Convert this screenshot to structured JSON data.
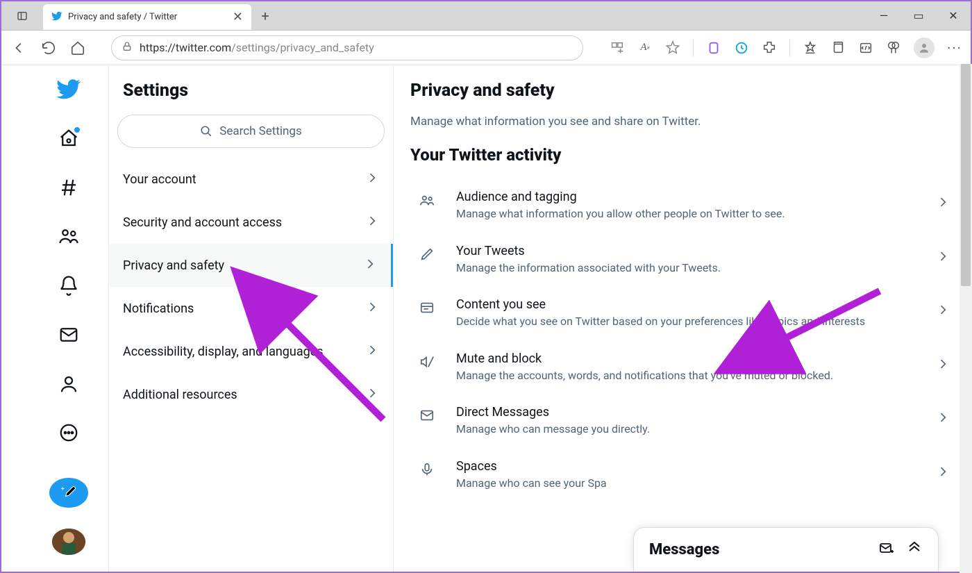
{
  "browser": {
    "tab_title": "Privacy and safety / Twitter",
    "url_prefix": "https://",
    "url_host": "twitter.com",
    "url_path": "/settings/privacy_and_safety"
  },
  "settings_sidebar": {
    "title": "Settings",
    "search_placeholder": "Search Settings",
    "items": [
      {
        "label": "Your account",
        "active": false
      },
      {
        "label": "Security and account access",
        "active": false
      },
      {
        "label": "Privacy and safety",
        "active": true
      },
      {
        "label": "Notifications",
        "active": false
      },
      {
        "label": "Accessibility, display, and languages",
        "active": false
      },
      {
        "label": "Additional resources",
        "active": false
      }
    ]
  },
  "main": {
    "title": "Privacy and safety",
    "subtitle": "Manage what information you see and share on Twitter.",
    "section_title": "Your Twitter activity",
    "items": [
      {
        "icon": "people",
        "title": "Audience and tagging",
        "desc": "Manage what information you allow other people on Twitter to see."
      },
      {
        "icon": "pencil",
        "title": "Your Tweets",
        "desc": "Manage the information associated with your Tweets."
      },
      {
        "icon": "feed",
        "title": "Content you see",
        "desc": "Decide what you see on Twitter based on your preferences like Topics and interests"
      },
      {
        "icon": "mute",
        "title": "Mute and block",
        "desc": "Manage the accounts, words, and notifications that you've muted or blocked."
      },
      {
        "icon": "envelope",
        "title": "Direct Messages",
        "desc": "Manage who can message you directly."
      },
      {
        "icon": "mic",
        "title": "Spaces",
        "desc": "Manage who can see your Spa"
      }
    ]
  },
  "messages_dock": {
    "title": "Messages"
  }
}
